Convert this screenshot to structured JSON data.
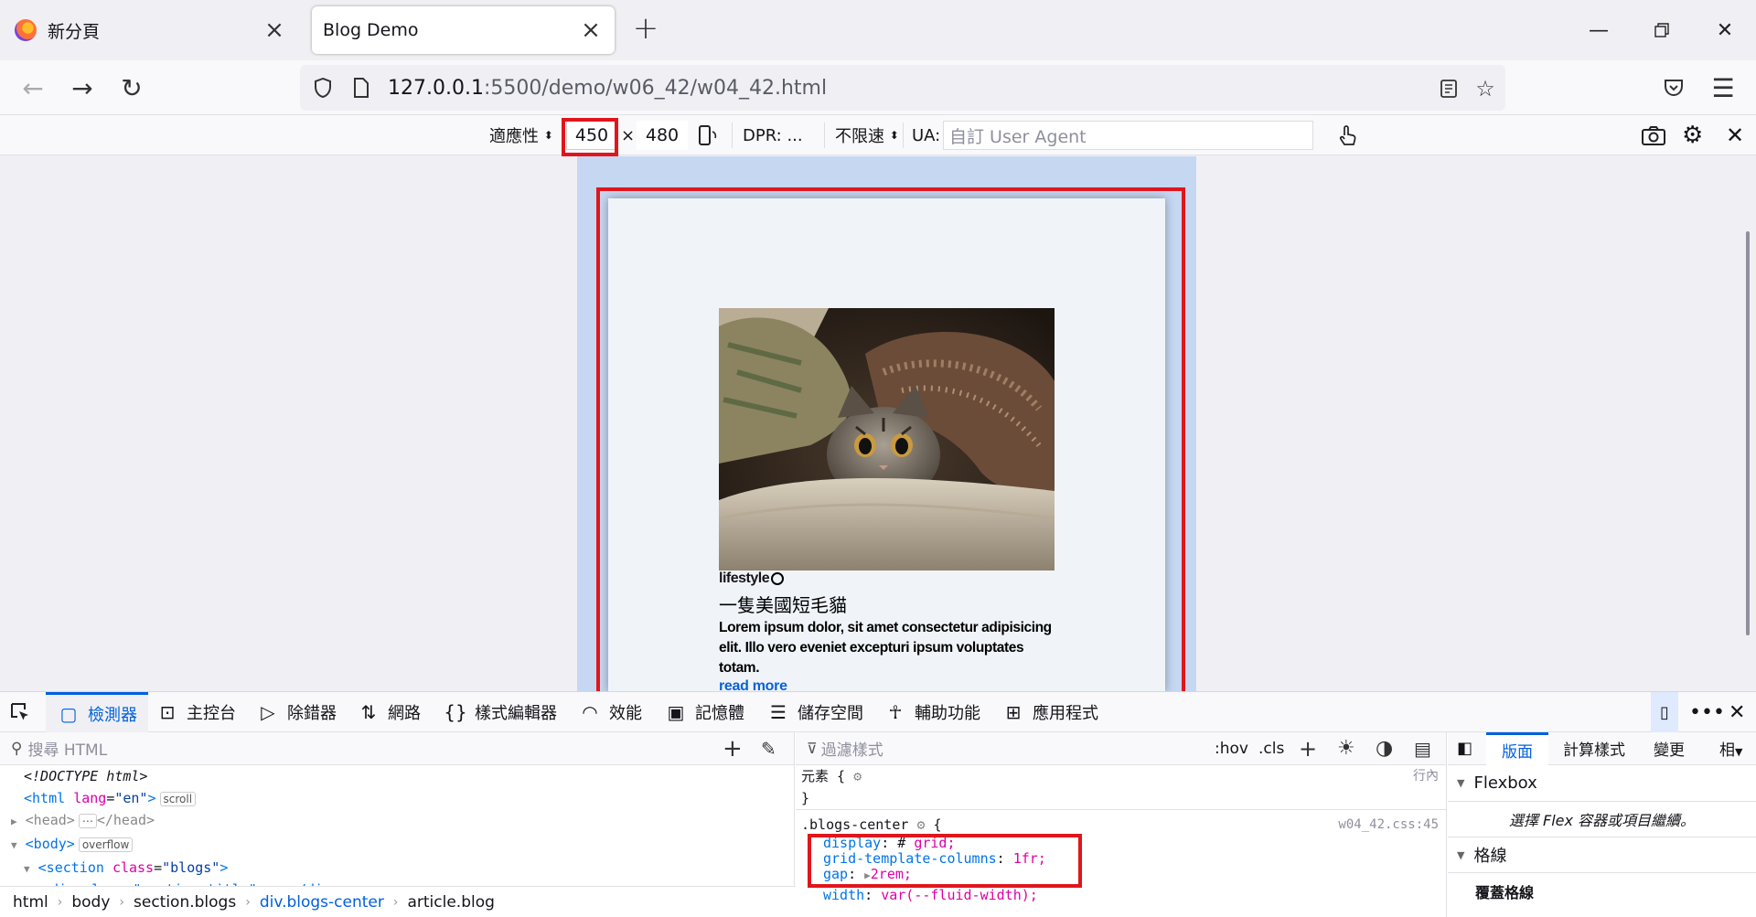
{
  "browser": {
    "tabs": [
      {
        "label": "新分頁",
        "active": false
      },
      {
        "label": "Blog Demo",
        "active": true
      }
    ],
    "url_host": "127.0.0.1",
    "url_path": ":5500/demo/w06_42/w04_42.html"
  },
  "rdm": {
    "device": "適應性",
    "width": "450",
    "x": "×",
    "height": "480",
    "dpr": "DPR: ...",
    "throttle": "不限速",
    "ua_label": "UA:",
    "ua_placeholder": "自訂 User Agent"
  },
  "blog": {
    "tag": "lifestyle",
    "title": "一隻美國短毛貓",
    "desc": "Lorem ipsum dolor, sit amet consectetur adipisicing elit. Illo vero eveniet excepturi ipsum voluptates totam.",
    "read_more": "read more"
  },
  "devtools": {
    "tabs": [
      "檢測器",
      "主控台",
      "除錯器",
      "網路",
      "樣式編輯器",
      "效能",
      "記憶體",
      "儲存空間",
      "輔助功能",
      "應用程式"
    ],
    "search_placeholder": "搜尋 HTML",
    "filter_placeholder": "過濾樣式",
    "hov": ":hov",
    "cls": ".cls",
    "html_lines": {
      "doctype": "<!DOCTYPE html>",
      "html_open": "<html",
      "html_lang_attr": "lang",
      "html_lang_val": "\"en\"",
      "html_close": ">",
      "scroll_badge": "scroll",
      "head": "<head>",
      "head_dots": "⋯",
      "head_close": "</head>",
      "body": "<body>",
      "overflow_badge": "overflow",
      "section_open": "<section",
      "section_class_attr": "class",
      "section_class_val": "\"blogs\"",
      "section_close": ">",
      "div_line": "<div class=\"section-title\"> ⋯ </div>"
    },
    "css": {
      "element_rule": "元素 {",
      "element_close": "}",
      "inline": "行內",
      "selector": ".blogs-center",
      "brace": "{",
      "source": "w04_42.css:45",
      "decls": [
        {
          "prop": "display",
          "val": "grid;"
        },
        {
          "prop": "grid-template-columns",
          "val": "1fr;"
        },
        {
          "prop": "gap",
          "val": "2rem;"
        },
        {
          "prop": "width",
          "val": "var(--fluid-width);"
        }
      ]
    },
    "layout_tabs": [
      "版面",
      "計算樣式",
      "變更",
      "相"
    ],
    "flexbox_header": "Flexbox",
    "flexbox_hint": "選擇 Flex 容器或項目繼續。",
    "grid_header": "格線",
    "grid_overlay": "覆蓋格線",
    "breadcrumbs": [
      "html",
      "body",
      "section.blogs",
      "div.blogs-center",
      "article.blog"
    ]
  },
  "colors": {
    "accent": "#0060df",
    "highlight_red": "#e0161c",
    "device_frame": "#c6d7f2",
    "link": "#0a62d6"
  }
}
